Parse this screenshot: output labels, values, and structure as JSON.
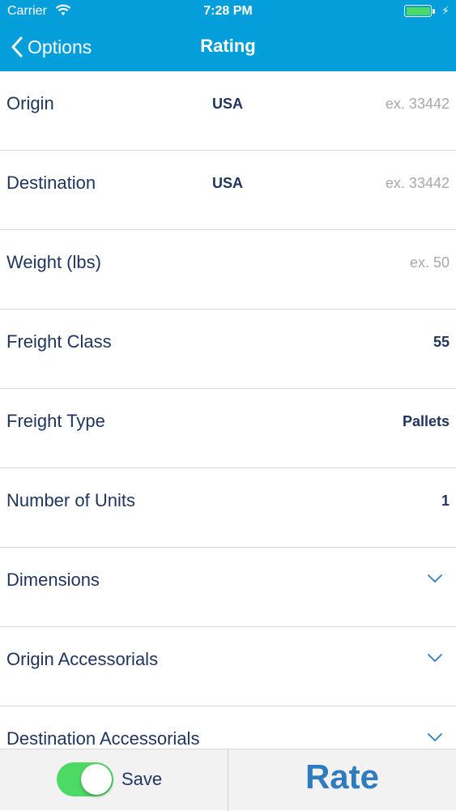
{
  "status_bar": {
    "carrier": "Carrier",
    "time": "7:28 PM"
  },
  "nav": {
    "back_label": "Options",
    "title": "Rating"
  },
  "rows": [
    {
      "label": "Origin",
      "country": "USA",
      "placeholder": "ex. 33442"
    },
    {
      "label": "Destination",
      "country": "USA",
      "placeholder": "ex. 33442"
    },
    {
      "label": "Weight (lbs)",
      "placeholder": "ex. 50"
    },
    {
      "label": "Freight Class",
      "value": "55"
    },
    {
      "label": "Freight Type",
      "value": "Pallets"
    },
    {
      "label": "Number of Units",
      "value": "1"
    },
    {
      "label": "Dimensions"
    },
    {
      "label": "Origin Accessorials"
    },
    {
      "label": "Destination Accessorials"
    }
  ],
  "bottom": {
    "save_label": "Save",
    "save_on": true,
    "rate_label": "Rate"
  },
  "colors": {
    "header": "#049fdb",
    "text": "#1f3560",
    "accent": "#2e7bbf",
    "toggle": "#4cd964"
  }
}
